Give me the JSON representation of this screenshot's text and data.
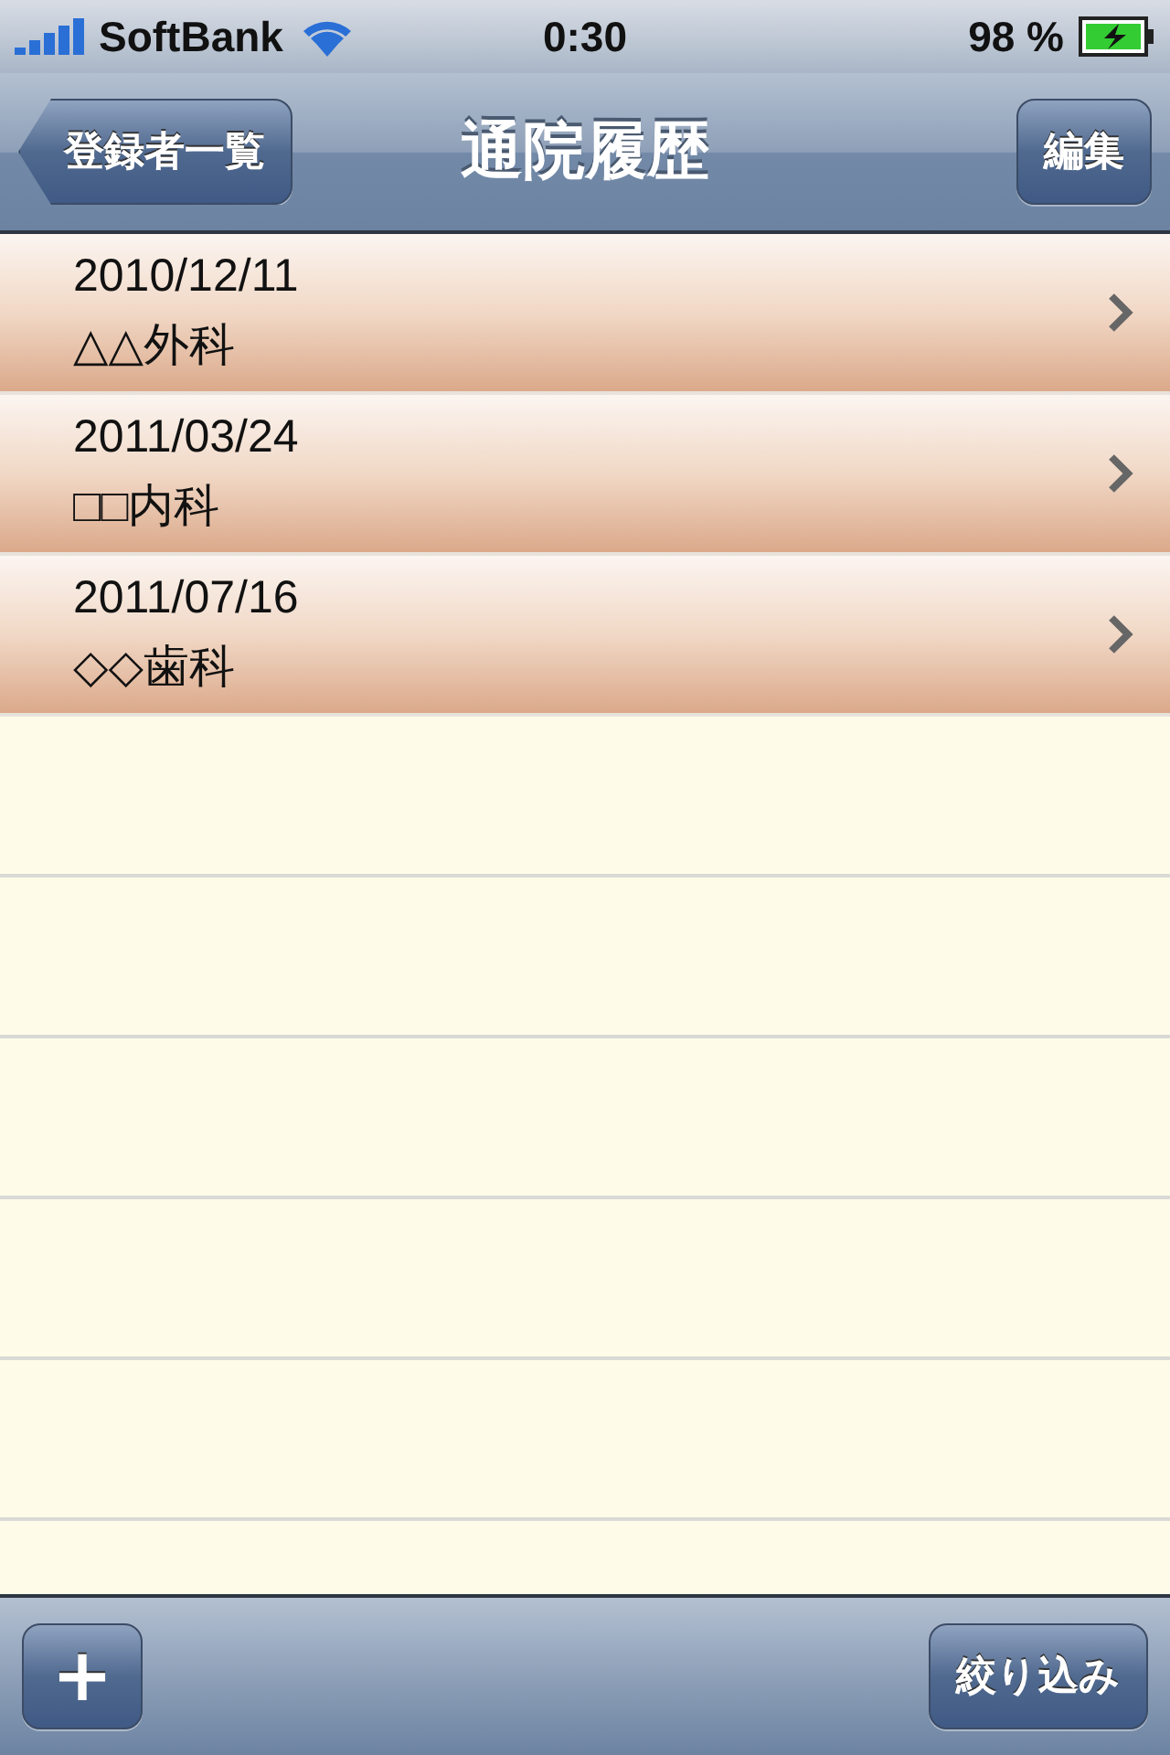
{
  "status_bar": {
    "carrier": "SoftBank",
    "time": "0:30",
    "battery": "98 %"
  },
  "nav_bar": {
    "back": "登録者一覧",
    "title": "通院履歴",
    "action": "編集"
  },
  "visits": [
    {
      "date": "2010/12/11",
      "clinic": "△△外科"
    },
    {
      "date": "2011/03/24",
      "clinic": "□□内科"
    },
    {
      "date": "2011/07/16",
      "clinic": "◇◇歯科"
    }
  ],
  "toolbar": {
    "add": "+",
    "filter": "絞り込み"
  }
}
